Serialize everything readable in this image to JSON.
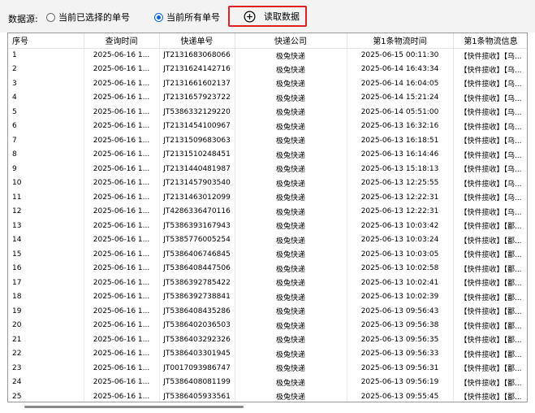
{
  "toolbar": {
    "source_label": "数据源:",
    "option_selected": "当前已选择的单号",
    "option_all": "当前所有单号",
    "read_button": "读取数据"
  },
  "columns": [
    "序号",
    "查询时间",
    "快递单号",
    "快递公司",
    "第1条物流时间",
    "第1条物流信息"
  ],
  "rows": [
    [
      "1",
      "2025-06-16 1...",
      "JT2131683068066",
      "极兔快递",
      "2025-06-15 00:11:30",
      "【快件揽收】【乌..."
    ],
    [
      "2",
      "2025-06-16 1...",
      "JT2131624142716",
      "极兔快递",
      "2025-06-14 16:43:34",
      "【快件揽收】【乌..."
    ],
    [
      "3",
      "2025-06-16 1...",
      "JT2131661602137",
      "极兔快递",
      "2025-06-14 16:04:05",
      "【快件揽收】【乌..."
    ],
    [
      "4",
      "2025-06-16 1...",
      "JT2131657923722",
      "极兔快递",
      "2025-06-14 15:21:24",
      "【快件揽收】【乌..."
    ],
    [
      "5",
      "2025-06-16 1...",
      "JT5386332129220",
      "极兔快递",
      "2025-06-14 05:51:00",
      "【快件揽收】【乌..."
    ],
    [
      "6",
      "2025-06-16 1...",
      "JT2131454100967",
      "极兔快递",
      "2025-06-13 16:32:16",
      "【快件揽收】【乌..."
    ],
    [
      "7",
      "2025-06-16 1...",
      "JT2131509683063",
      "极兔快递",
      "2025-06-13 16:18:51",
      "【快件揽收】【乌..."
    ],
    [
      "8",
      "2025-06-16 1...",
      "JT2131510248451",
      "极兔快递",
      "2025-06-13 16:14:46",
      "【快件揽收】【乌..."
    ],
    [
      "9",
      "2025-06-16 1...",
      "JT2131440481987",
      "极兔快递",
      "2025-06-13 15:18:13",
      "【快件揽收】【乌..."
    ],
    [
      "10",
      "2025-06-16 1...",
      "JT2131457903540",
      "极兔快递",
      "2025-06-13 12:25:55",
      "【快件揽收】【乌..."
    ],
    [
      "11",
      "2025-06-16 1...",
      "JT2131463012099",
      "极兔快递",
      "2025-06-13 12:22:31",
      "【快件揽收】【乌..."
    ],
    [
      "12",
      "2025-06-16 1...",
      "JT4286336470116",
      "极兔快递",
      "2025-06-13 12:22:31",
      "【快件揽收】【乌..."
    ],
    [
      "13",
      "2025-06-16 1...",
      "JT5386393167943",
      "极兔快递",
      "2025-06-13 10:03:42",
      "【快件揽收】【鄱..."
    ],
    [
      "14",
      "2025-06-16 1...",
      "JT5385776005254",
      "极兔快递",
      "2025-06-13 10:03:24",
      "【快件揽收】【鄱..."
    ],
    [
      "15",
      "2025-06-16 1...",
      "JT5386406746845",
      "极兔快递",
      "2025-06-13 10:03:05",
      "【快件揽收】【鄱..."
    ],
    [
      "16",
      "2025-06-16 1...",
      "JT5386408447506",
      "极兔快递",
      "2025-06-13 10:02:58",
      "【快件揽收】【鄱..."
    ],
    [
      "17",
      "2025-06-16 1...",
      "JT5386392785422",
      "极兔快递",
      "2025-06-13 10:02:41",
      "【快件揽收】【鄱..."
    ],
    [
      "18",
      "2025-06-16 1...",
      "JT5386392738841",
      "极兔快递",
      "2025-06-13 10:02:39",
      "【快件揽收】【鄱..."
    ],
    [
      "19",
      "2025-06-16 1...",
      "JT5386408435286",
      "极兔快递",
      "2025-06-13 09:56:43",
      "【快件揽收】【鄱..."
    ],
    [
      "20",
      "2025-06-16 1...",
      "JT5386402036503",
      "极兔快递",
      "2025-06-13 09:56:38",
      "【快件揽收】【鄱..."
    ],
    [
      "21",
      "2025-06-16 1...",
      "JT5386403292326",
      "极兔快递",
      "2025-06-13 09:56:35",
      "【快件揽收】【鄱..."
    ],
    [
      "22",
      "2025-06-16 1...",
      "JT5386403301945",
      "极兔快递",
      "2025-06-13 09:56:33",
      "【快件揽收】【鄱..."
    ],
    [
      "23",
      "2025-06-16 1...",
      "JT0017093986747",
      "极兔快递",
      "2025-06-13 09:56:31",
      "【快件揽收】【鄱..."
    ],
    [
      "24",
      "2025-06-16 1...",
      "JT5386408081199",
      "极兔快递",
      "2025-06-13 09:56:19",
      "【快件揽收】【鄱..."
    ],
    [
      "25",
      "2025-06-16 1...",
      "JT5386405933561",
      "极兔快递",
      "2025-06-13 09:55:45",
      "【快件揽收】【鄱..."
    ],
    [
      "",
      "",
      "",
      "极兔快递",
      "",
      "【快件揽收】【鄱..."
    ]
  ],
  "colors": {
    "radio_accent": "#0a64d6",
    "highlight_border": "#e02020"
  }
}
